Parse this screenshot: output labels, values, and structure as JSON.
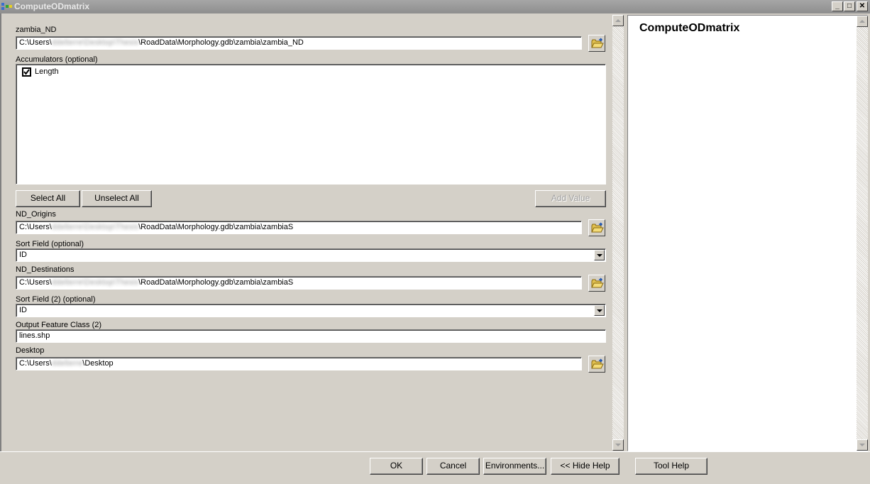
{
  "window": {
    "title": "ComputeODmatrix",
    "minimize_label": "_",
    "maximize_label": "□",
    "close_label": "✕"
  },
  "form": {
    "network_dataset": {
      "label": "zambia_ND",
      "value_prefix": "C:\\Users\\",
      "value_redacted": "ddelterre\\Desktop\\Thesis",
      "value_suffix": "\\RoadData\\Morphology.gdb\\zambia\\zambia_ND"
    },
    "accumulators": {
      "label": "Accumulators (optional)",
      "items": [
        {
          "label": "Length",
          "checked": true
        }
      ],
      "select_all_label": "Select All",
      "unselect_all_label": "Unselect All",
      "add_value_label": "Add Value"
    },
    "origins": {
      "label": "ND_Origins",
      "value_prefix": "C:\\Users\\",
      "value_redacted": "ddelterre\\Desktop\\Thesis",
      "value_suffix": "\\RoadData\\Morphology.gdb\\zambia\\zambiaS"
    },
    "sort_field": {
      "label": "Sort Field (optional)",
      "value": "ID"
    },
    "destinations": {
      "label": "ND_Destinations",
      "value_prefix": "C:\\Users\\",
      "value_redacted": "ddelterre\\Desktop\\Thesis",
      "value_suffix": "\\RoadData\\Morphology.gdb\\zambia\\zambiaS"
    },
    "sort_field_2": {
      "label": "Sort Field (2) (optional)",
      "value": "ID"
    },
    "output_feature_class": {
      "label": "Output Feature Class (2)",
      "value": "lines.shp"
    },
    "desktop": {
      "label": "Desktop",
      "value_prefix": "C:\\Users\\",
      "value_redacted": "ddelterre",
      "value_suffix": "\\Desktop"
    }
  },
  "help": {
    "title": "ComputeODmatrix"
  },
  "footer": {
    "ok_label": "OK",
    "cancel_label": "Cancel",
    "environments_label": "Environments...",
    "hide_help_label": "<< Hide Help",
    "tool_help_label": "Tool Help"
  }
}
